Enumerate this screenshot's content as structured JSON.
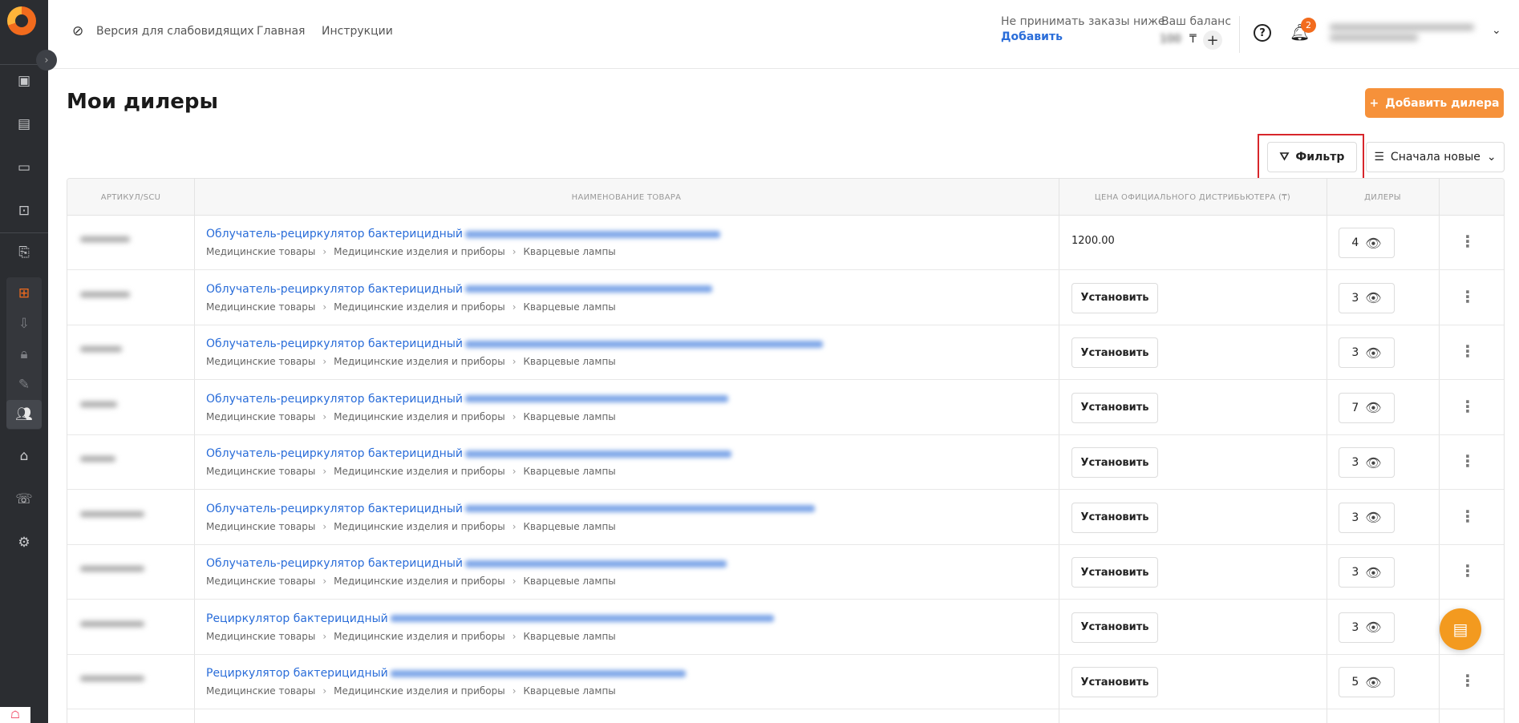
{
  "header": {
    "accessibility_label": "Версия для слабовидящих",
    "nav": [
      "Главная",
      "Инструкции"
    ],
    "orders_label": "Не принимать заказы ниже",
    "orders_link": "Добавить",
    "balance_label": "Ваш баланс",
    "balance_value": "100",
    "balance_currency": "₸",
    "notifications_count": "2"
  },
  "page": {
    "title": "Мои дилеры",
    "add_dealer_label": "Добавить дилера",
    "filter_label": "Фильтр",
    "sort_label": "Сначала новые"
  },
  "table": {
    "columns": [
      "АРТИКУЛ/SCU",
      "НАИМЕНОВАНИЕ ТОВАРА",
      "ЦЕНА ОФИЦИАЛЬНОГО ДИСТРИБЬЮТЕРА (₸)",
      "ДИЛЕРЫ"
    ],
    "crumbs": [
      "Медицинские товары",
      "Медицинские изделия и приборы",
      "Кварцевые лампы"
    ],
    "set_price_label": "Установить",
    "rows": [
      {
        "name": "Облучатель-рециркулятор бактерицидный",
        "price": "1200.00",
        "dealers": "4"
      },
      {
        "name": "Облучатель-рециркулятор бактерицидный",
        "price": "",
        "dealers": "3"
      },
      {
        "name": "Облучатель-рециркулятор бактерицидный",
        "price": "",
        "dealers": "3"
      },
      {
        "name": "Облучатель-рециркулятор бактерицидный",
        "price": "",
        "dealers": "7"
      },
      {
        "name": "Облучатель-рециркулятор бактерицидный",
        "price": "",
        "dealers": "3"
      },
      {
        "name": "Облучатель-рециркулятор бактерицидный",
        "price": "",
        "dealers": "3"
      },
      {
        "name": "Облучатель-рециркулятор бактерицидный",
        "price": "",
        "dealers": "3"
      },
      {
        "name": "Рециркулятор бактерицидный",
        "price": "",
        "dealers": "3"
      },
      {
        "name": "Рециркулятор бактерицидный",
        "price": "",
        "dealers": "5"
      }
    ]
  },
  "colors": {
    "accent": "#f6913a",
    "link": "#2a6dd9",
    "sidebar": "#2b2d31",
    "highlight": "#d7262b"
  }
}
